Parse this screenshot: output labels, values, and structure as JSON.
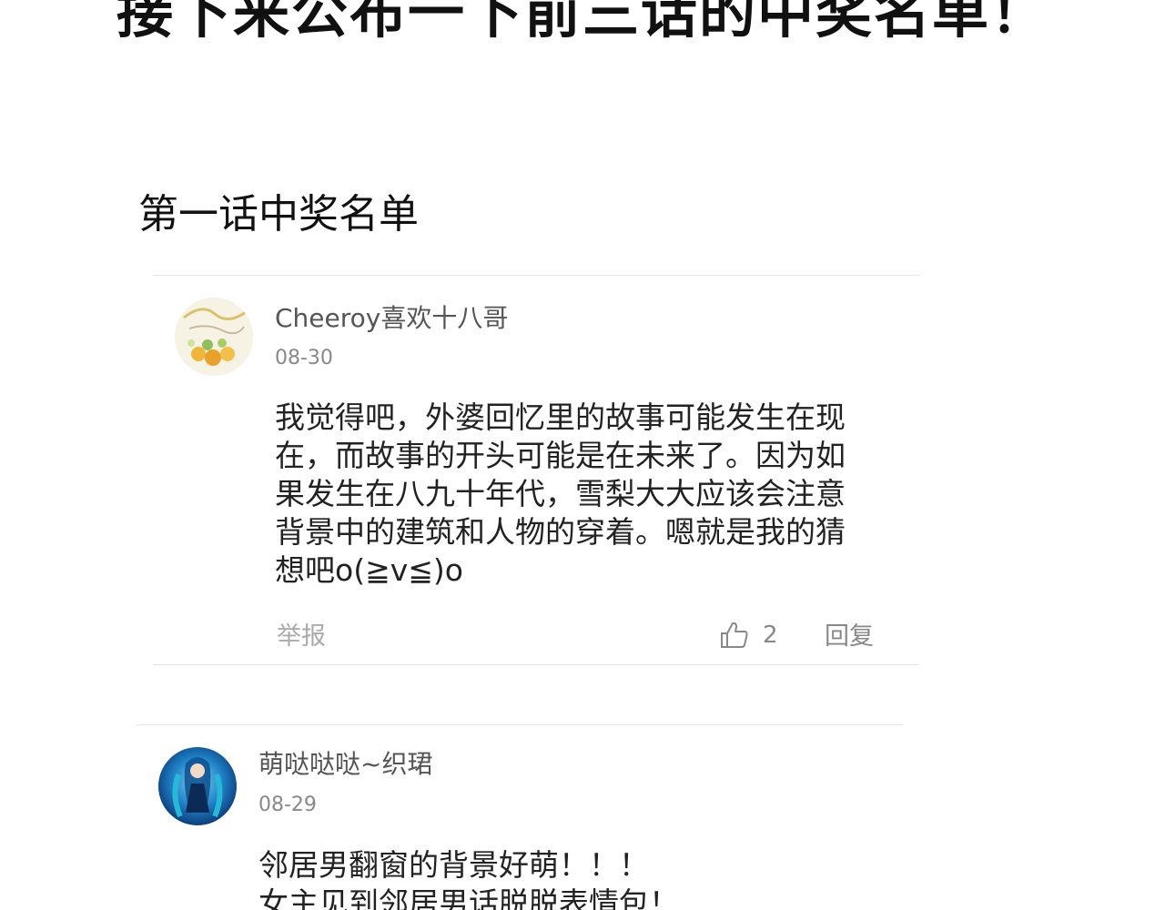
{
  "headline": "接下来公布一下前三话的中奖名单！",
  "section_title": "第一话中奖名单",
  "comments": [
    {
      "username": "Cheeroy喜欢十八哥",
      "date": "08-30",
      "lines": [
        "我觉得吧，外婆回忆里的故事可能发生在现",
        "在，而故事的开头可能是在未来了。因为如",
        "果发生在八九十年代，雪梨大大应该会注意",
        "背景中的建筑和人物的穿着。嗯就是我的猜",
        "想吧o(≧v≦)o"
      ],
      "report_label": "举报",
      "like_icon": "thumbs-up-icon",
      "like_count": "2",
      "reply_label": "回复"
    },
    {
      "username": "萌哒哒哒~织珺",
      "date": "08-29",
      "lines": [
        "邻居男翻窗的背景好萌！！！",
        "女主见到邻居男话脱脱表情包！"
      ]
    }
  ]
}
